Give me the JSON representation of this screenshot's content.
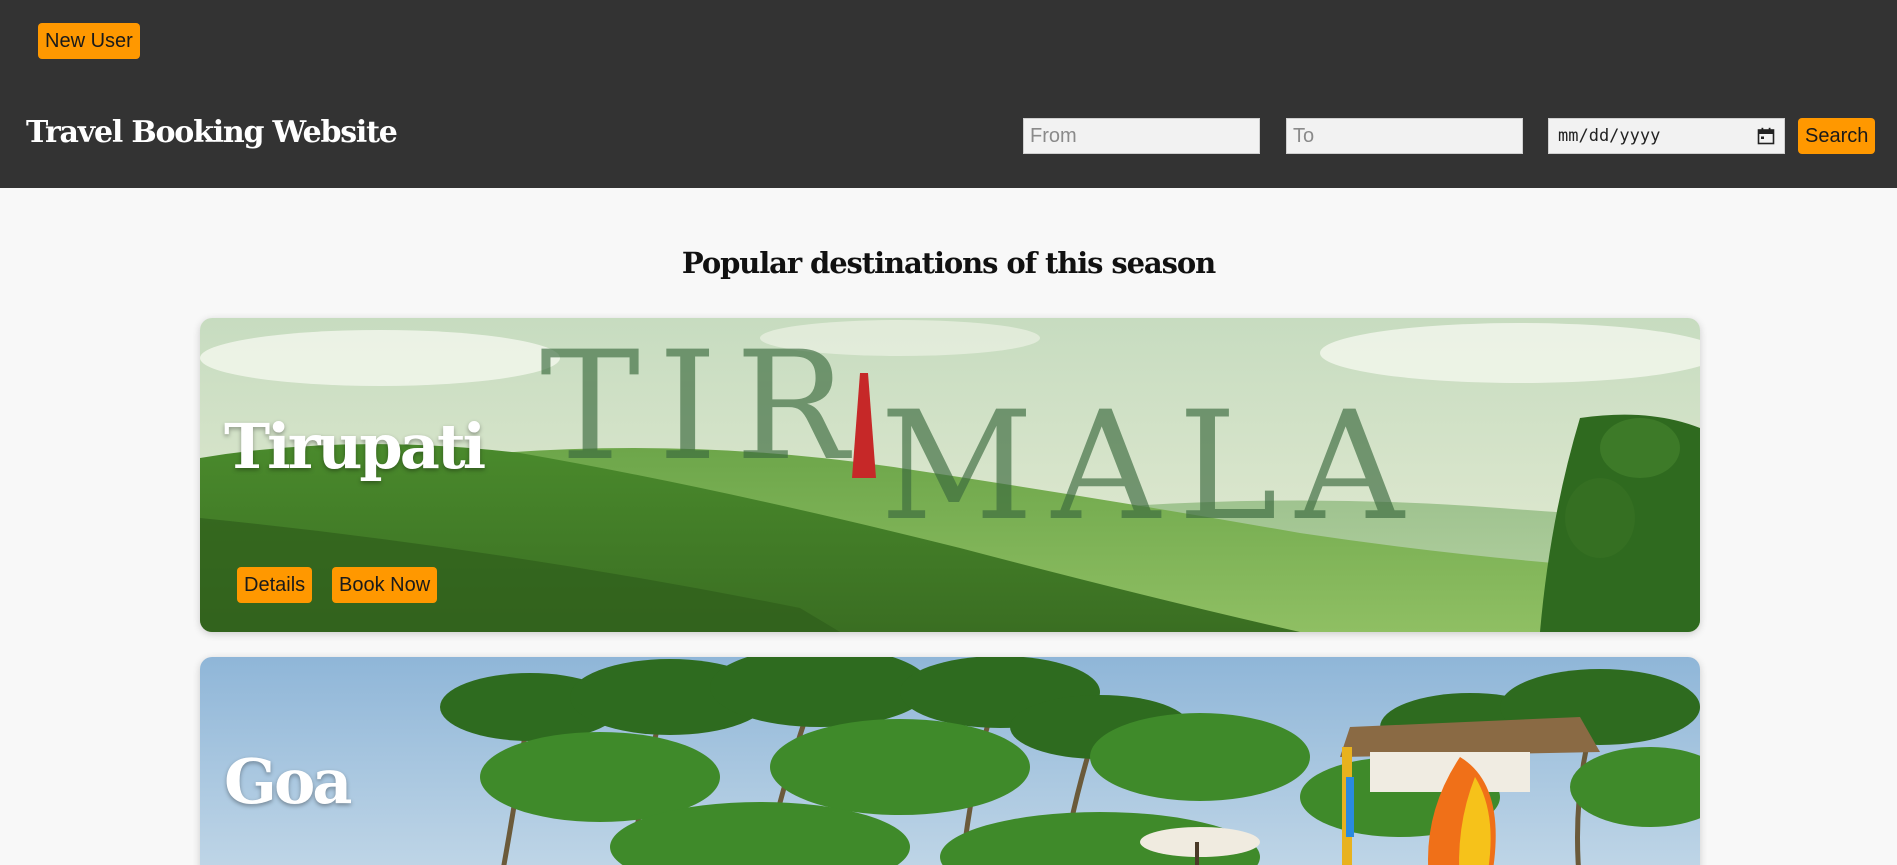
{
  "header": {
    "new_user_label": "New User",
    "title": "Travel Booking Website",
    "search": {
      "from_placeholder": "From",
      "to_placeholder": "To",
      "date_placeholder": "mm/dd/yyyy",
      "search_label": "Search"
    }
  },
  "main": {
    "section_title": "Popular destinations of this season",
    "destinations": [
      {
        "name": "Tirupati",
        "banner_text": "TIRUMALA",
        "details_label": "Details",
        "book_label": "Book Now"
      },
      {
        "name": "Goa"
      }
    ]
  },
  "colors": {
    "header_bg": "#333333",
    "accent": "#ff9800",
    "page_bg": "#f8f8f8"
  },
  "icons": {
    "date_picker": "calendar-icon"
  }
}
